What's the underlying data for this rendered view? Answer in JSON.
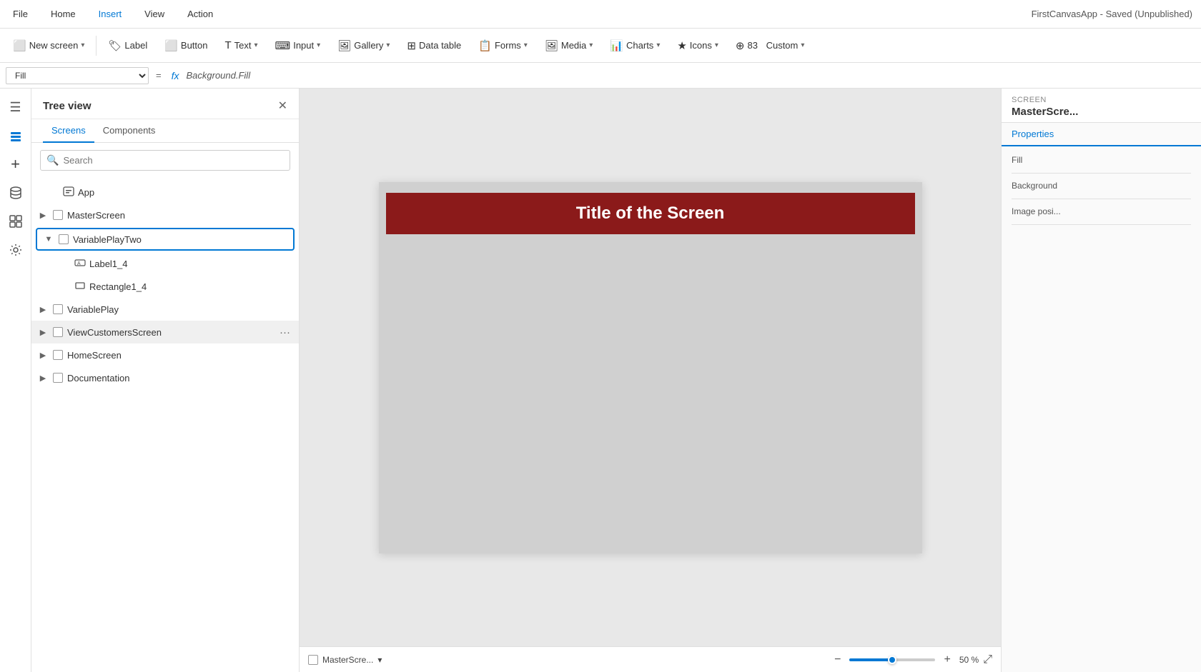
{
  "app": {
    "title": "FirstCanvasApp - Saved (Unpublished)"
  },
  "menu": {
    "items": [
      "File",
      "Home",
      "Insert",
      "View",
      "Action"
    ],
    "active": "Insert"
  },
  "toolbar": {
    "new_screen_label": "New screen",
    "label_label": "Label",
    "button_label": "Button",
    "text_label": "Text",
    "input_label": "Input",
    "gallery_label": "Gallery",
    "data_table_label": "Data table",
    "forms_label": "Forms",
    "media_label": "Media",
    "charts_label": "Charts",
    "icons_label": "Icons",
    "custom_label": "Custom",
    "custom_count": "83"
  },
  "formula_bar": {
    "property": "Fill",
    "formula": "Background.Fill"
  },
  "tree_view": {
    "title": "Tree view",
    "tabs": [
      "Screens",
      "Components"
    ],
    "active_tab": "Screens",
    "search_placeholder": "Search",
    "items": [
      {
        "id": "app",
        "label": "App",
        "level": 0,
        "has_chevron": false,
        "chevron_open": false,
        "icon": "🖥"
      },
      {
        "id": "masterscreen",
        "label": "MasterScreen",
        "level": 0,
        "has_chevron": true,
        "chevron_open": false,
        "icon": ""
      },
      {
        "id": "variableplaytwo",
        "label": "VariablePlayTwo",
        "level": 0,
        "has_chevron": true,
        "chevron_open": true,
        "icon": "",
        "editing": true
      },
      {
        "id": "label1_4",
        "label": "Label1_4",
        "level": 2,
        "has_chevron": false,
        "icon": "🏷"
      },
      {
        "id": "rectangle1_4",
        "label": "Rectangle1_4",
        "level": 2,
        "has_chevron": false,
        "icon": "▭"
      },
      {
        "id": "variableplay",
        "label": "VariablePlay",
        "level": 0,
        "has_chevron": true,
        "chevron_open": false,
        "icon": ""
      },
      {
        "id": "viewcustomersscreen",
        "label": "ViewCustomersScreen",
        "level": 0,
        "has_chevron": true,
        "chevron_open": false,
        "icon": "",
        "hover_actions": true
      },
      {
        "id": "homescreen",
        "label": "HomeScreen",
        "level": 0,
        "has_chevron": true,
        "chevron_open": false,
        "icon": ""
      },
      {
        "id": "documentation",
        "label": "Documentation",
        "level": 0,
        "has_chevron": true,
        "chevron_open": false,
        "icon": ""
      }
    ]
  },
  "canvas": {
    "screen_title": "Title of the Screen",
    "screen_bg_color": "#8b1a1a",
    "screen_indicator_label": "MasterScre...",
    "zoom_level": "50",
    "zoom_pct_label": "50 %"
  },
  "right_panel": {
    "section_label": "SCREEN",
    "screen_name": "MasterScre...",
    "active_tab": "Properties",
    "tabs": [
      "Properties"
    ],
    "properties": [
      {
        "label": "Fill",
        "value": ""
      },
      {
        "label": "Background",
        "value": ""
      },
      {
        "label": "Image posi...",
        "value": ""
      }
    ]
  },
  "left_icons": [
    {
      "name": "hamburger-icon",
      "glyph": "☰"
    },
    {
      "name": "layers-icon",
      "glyph": "◫",
      "active": true
    },
    {
      "name": "add-icon",
      "glyph": "+"
    },
    {
      "name": "database-icon",
      "glyph": "⊞"
    },
    {
      "name": "components-icon",
      "glyph": "❏"
    },
    {
      "name": "settings-icon",
      "glyph": "🔧"
    }
  ]
}
